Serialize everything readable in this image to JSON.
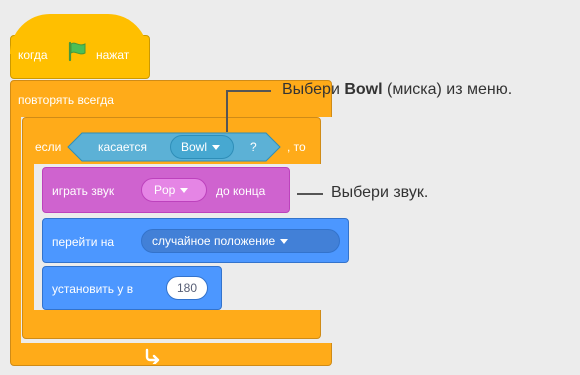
{
  "script": {
    "hat": {
      "prefix": "когда",
      "suffix": "нажат",
      "icon": "green-flag-icon"
    },
    "forever": {
      "label": "повторять всегда",
      "icon": "loop-arrow-icon"
    },
    "if_block": {
      "prefix": "если",
      "suffix": ", то"
    },
    "touching": {
      "label": "касается",
      "value": "Bowl",
      "question": "?"
    },
    "play_sound": {
      "prefix": "играть звук",
      "value": "Pop",
      "suffix": "до конца"
    },
    "go_to": {
      "prefix": "перейти на",
      "value": "случайное положение"
    },
    "set_y": {
      "prefix": "установить y в",
      "value": "180"
    }
  },
  "annotations": {
    "bowl": {
      "before": "Выбери ",
      "bold": "Bowl",
      "after": " (миска) из меню."
    },
    "sound": {
      "text": "Выбери звук."
    }
  },
  "colors": {
    "events": "#ffbf00",
    "control": "#ffab19",
    "sound": "#cf63cf",
    "motion": "#4c97ff",
    "sensing": "#5cb1d6",
    "flag": "#4cbf56"
  }
}
